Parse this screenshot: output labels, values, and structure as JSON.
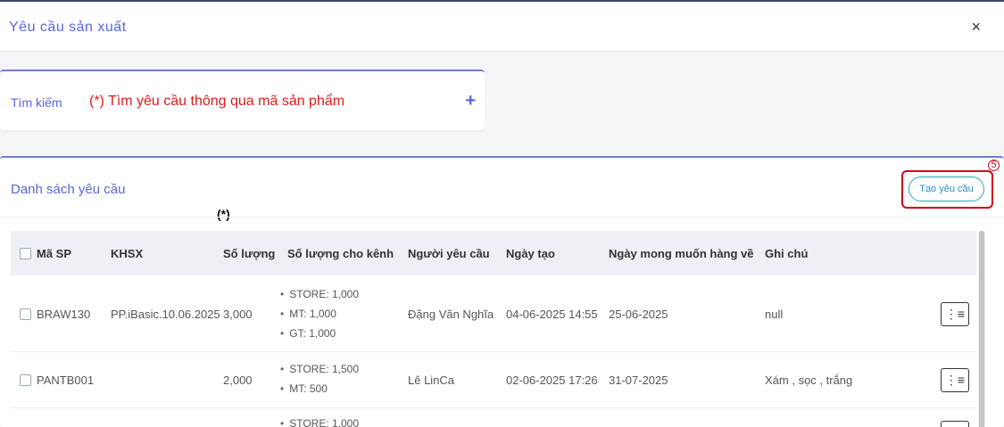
{
  "header": {
    "title": "Yêu cầu sản xuất",
    "close_icon": "×"
  },
  "search": {
    "label": "Tìm kiếm",
    "note": "(*) Tìm yêu cầu thông qua mã sản phẩm",
    "expand_icon": "+"
  },
  "list": {
    "title": "Danh sách yêu cầu",
    "star_note": "(*)",
    "badge": "5",
    "create_button": "Tạo yêu cầu",
    "columns": [
      "Mã SP",
      "KHSX",
      "Số lượng",
      "Số lượng cho kênh",
      "Người yêu cầu",
      "Ngày tạo",
      "Ngày mong muốn hàng về",
      "Ghi chú"
    ],
    "rows": [
      {
        "code": "BRAW130",
        "plan": "PP.iBasic.10.06.2025",
        "qty": "3,000",
        "channels": [
          "STORE: 1,000",
          "MT: 1,000",
          "GT: 1,000"
        ],
        "requester": "Đặng Văn Nghĩa",
        "created": "04-06-2025 14:55",
        "desired": "25-06-2025",
        "note": "null",
        "menu_icon": "⋮≡"
      },
      {
        "code": "PANTB001",
        "plan": "",
        "qty": "2,000",
        "channels": [
          "STORE: 1,500",
          "MT: 500"
        ],
        "requester": "Lê LinCa",
        "created": "02-06-2025 17:26",
        "desired": "31-07-2025",
        "note": "Xám , sọc , trắng",
        "menu_icon": "⋮≡"
      },
      {
        "channels": [
          "STORE: 1,000"
        ]
      }
    ]
  }
}
